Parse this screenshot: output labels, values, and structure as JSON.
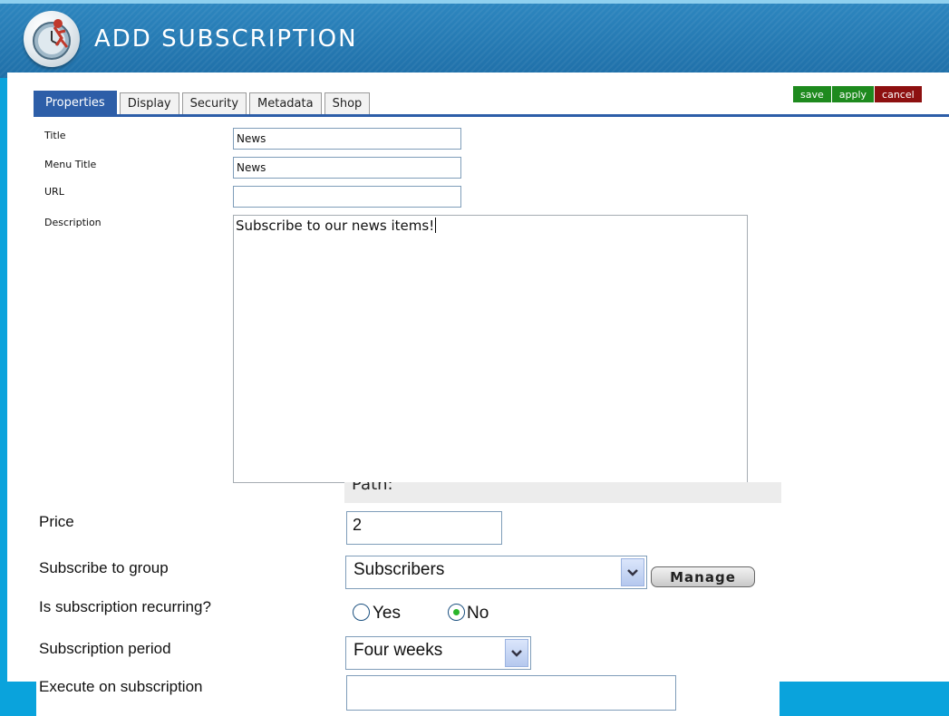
{
  "header": {
    "title": "ADD SUBSCRIPTION",
    "logo_icon": "clock-runner-logo-icon"
  },
  "tabs": [
    {
      "label": "Properties",
      "active": true
    },
    {
      "label": "Display",
      "active": false
    },
    {
      "label": "Security",
      "active": false
    },
    {
      "label": "Metadata",
      "active": false
    },
    {
      "label": "Shop",
      "active": false
    }
  ],
  "actions": {
    "save": "save",
    "apply": "apply",
    "cancel": "cancel"
  },
  "form": {
    "title": {
      "label": "Title",
      "value": "News"
    },
    "menu_title": {
      "label": "Menu Title",
      "value": "News"
    },
    "url": {
      "label": "URL",
      "value": ""
    },
    "description": {
      "label": "Description",
      "value": "Subscribe to our news items!"
    },
    "path": {
      "label": "Path:"
    },
    "price": {
      "label": "Price",
      "value": "2"
    },
    "group": {
      "label": "Subscribe to group",
      "value": "Subscribers",
      "manage_label": "Manage"
    },
    "recurring": {
      "label": "Is subscription recurring?",
      "yes_label": "Yes",
      "no_label": "No",
      "selected": "No"
    },
    "period": {
      "label": "Subscription period",
      "value": "Four weeks"
    },
    "execute": {
      "label": "Execute on subscription",
      "value": ""
    }
  },
  "colors": {
    "accent": "#2d5ea8",
    "save": "#1e8a1e",
    "cancel": "#8d1010",
    "background": "#0aa3dc"
  }
}
